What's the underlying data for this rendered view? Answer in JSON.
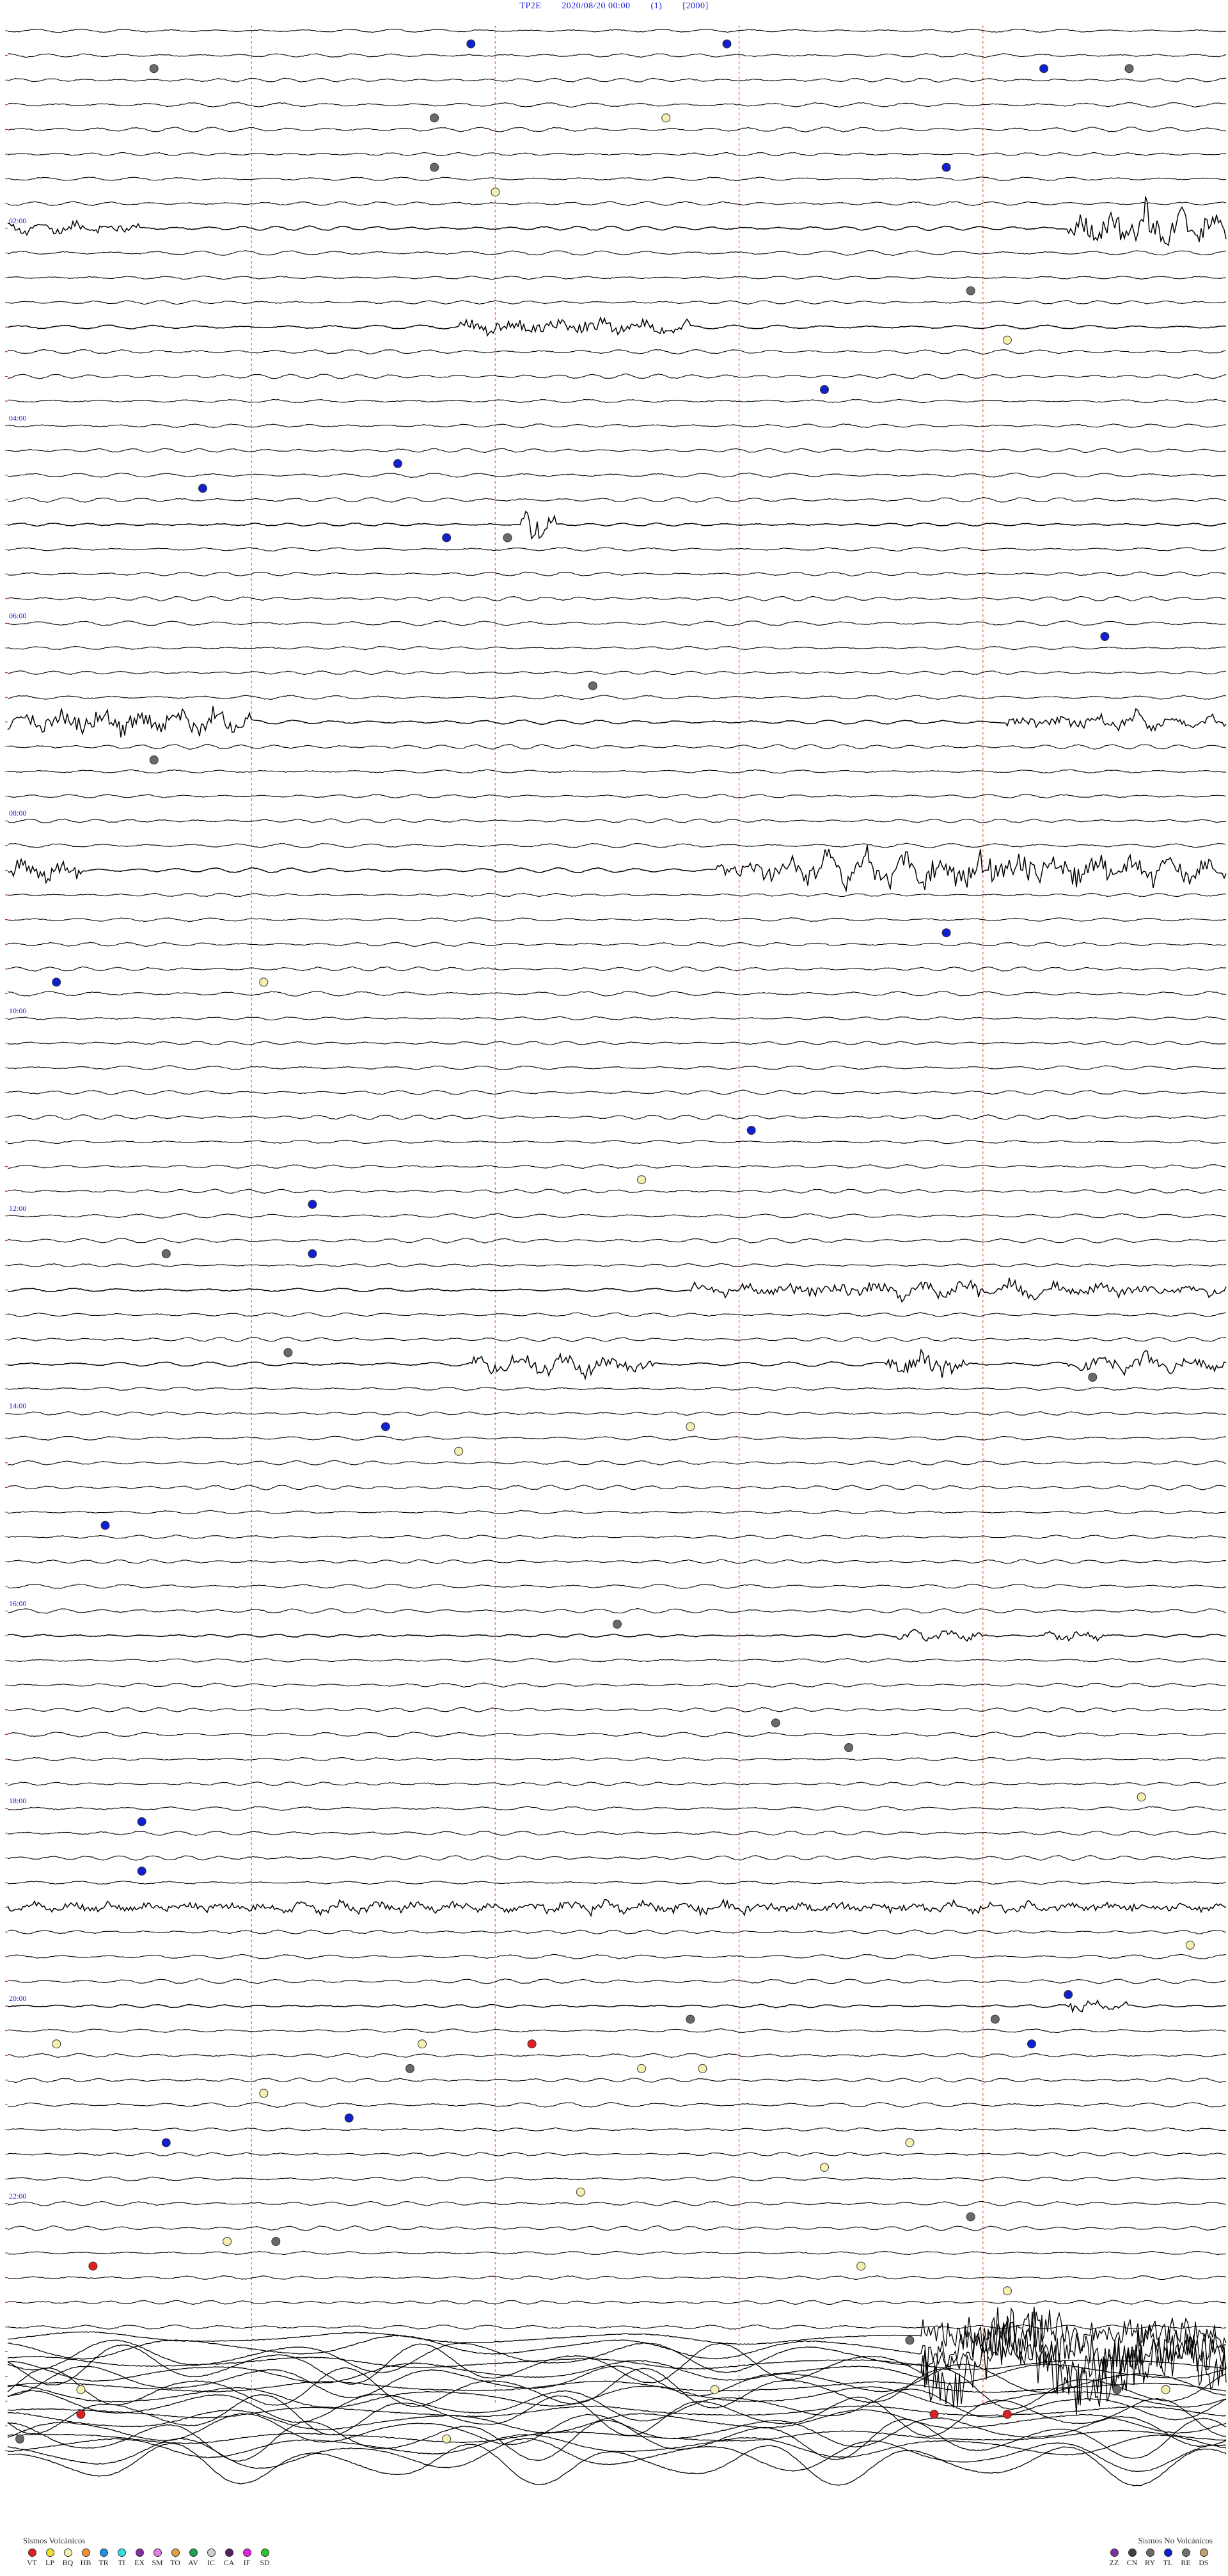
{
  "header": {
    "station": "TP2E",
    "datetime": "2020/08/20 00:00",
    "channel": "(1)",
    "scale": "[2000]"
  },
  "chart_data": {
    "type": "helicorder",
    "title": "TP2E   2020/08/20 00:00   (1)   [2000]",
    "lines_count": 96,
    "line_minutes": 15,
    "hour_labels": [
      {
        "line": 8,
        "text": "02:00"
      },
      {
        "line": 16,
        "text": "04:00"
      },
      {
        "line": 24,
        "text": "06:00"
      },
      {
        "line": 32,
        "text": "08:00"
      },
      {
        "line": 40,
        "text": "10:00"
      },
      {
        "line": 48,
        "text": "12:00"
      },
      {
        "line": 56,
        "text": "14:00"
      },
      {
        "line": 64,
        "text": "16:00"
      },
      {
        "line": 72,
        "text": "18:00"
      },
      {
        "line": 80,
        "text": "20:00"
      },
      {
        "line": 88,
        "text": "22:00"
      }
    ],
    "minute_markers": [
      3,
      6,
      9,
      12
    ],
    "bursts": [
      {
        "line": 8,
        "start": 0.87,
        "end": 1.0,
        "amp": 26,
        "dense": 2
      },
      {
        "line": 8,
        "start": 0.0,
        "end": 0.11,
        "amp": 5,
        "dense": 1
      },
      {
        "line": 12,
        "start": 0.37,
        "end": 0.56,
        "amp": 9,
        "dense": 1
      },
      {
        "line": 20,
        "start": 0.42,
        "end": 0.45,
        "amp": 24,
        "dense": 2
      },
      {
        "line": 28,
        "start": 0.0,
        "end": 0.2,
        "amp": 14,
        "dense": 2
      },
      {
        "line": 28,
        "start": 0.82,
        "end": 1.0,
        "amp": 7,
        "dense": 1
      },
      {
        "line": 34,
        "start": 0.0,
        "end": 0.06,
        "amp": 12,
        "dense": 1
      },
      {
        "line": 34,
        "start": 0.58,
        "end": 1.0,
        "amp": 18,
        "dense": 2
      },
      {
        "line": 51,
        "start": 0.56,
        "end": 1.0,
        "amp": 8,
        "dense": 1
      },
      {
        "line": 54,
        "start": 0.38,
        "end": 0.53,
        "amp": 12,
        "dense": 1
      },
      {
        "line": 54,
        "start": 0.72,
        "end": 0.79,
        "amp": 12,
        "dense": 1
      },
      {
        "line": 54,
        "start": 0.87,
        "end": 1.0,
        "amp": 8,
        "dense": 1
      },
      {
        "line": 65,
        "start": 0.73,
        "end": 0.8,
        "amp": 6,
        "dense": 1
      },
      {
        "line": 65,
        "start": 0.85,
        "end": 0.9,
        "amp": 6,
        "dense": 1
      },
      {
        "line": 76,
        "start": 0.0,
        "end": 1.0,
        "amp": 5,
        "dense": 1
      },
      {
        "line": 80,
        "start": 0.87,
        "end": 0.92,
        "amp": 7,
        "dense": 1
      },
      {
        "line": 94,
        "start": 0.75,
        "end": 1.0,
        "amp": 22,
        "dense": 2
      }
    ],
    "noisy_tail_from_line": 94,
    "event_markers": [
      {
        "line": 1,
        "pos": 0.59,
        "type": "TL"
      },
      {
        "line": 1,
        "pos": 0.38,
        "type": "TL"
      },
      {
        "line": 2,
        "pos": 0.85,
        "type": "TL"
      },
      {
        "line": 2,
        "pos": 0.12,
        "type": "RY"
      },
      {
        "line": 2,
        "pos": 0.92,
        "type": "RY"
      },
      {
        "line": 4,
        "pos": 0.35,
        "type": "RY"
      },
      {
        "line": 4,
        "pos": 0.54,
        "type": "BQ"
      },
      {
        "line": 6,
        "pos": 0.77,
        "type": "TL"
      },
      {
        "line": 6,
        "pos": 0.35,
        "type": "RY"
      },
      {
        "line": 7,
        "pos": 0.4,
        "type": "BQ"
      },
      {
        "line": 11,
        "pos": 0.79,
        "type": "RY"
      },
      {
        "line": 13,
        "pos": 0.82,
        "type": "BQ"
      },
      {
        "line": 15,
        "pos": 0.67,
        "type": "TL"
      },
      {
        "line": 18,
        "pos": 0.32,
        "type": "TL"
      },
      {
        "line": 19,
        "pos": 0.16,
        "type": "TL"
      },
      {
        "line": 21,
        "pos": 0.36,
        "type": "TL"
      },
      {
        "line": 21,
        "pos": 0.41,
        "type": "RY"
      },
      {
        "line": 25,
        "pos": 0.9,
        "type": "TL"
      },
      {
        "line": 27,
        "pos": 0.48,
        "type": "RY"
      },
      {
        "line": 30,
        "pos": 0.12,
        "type": "RY"
      },
      {
        "line": 37,
        "pos": 0.77,
        "type": "TL"
      },
      {
        "line": 39,
        "pos": 0.04,
        "type": "TL"
      },
      {
        "line": 39,
        "pos": 0.21,
        "type": "BQ"
      },
      {
        "line": 45,
        "pos": 0.61,
        "type": "TL"
      },
      {
        "line": 47,
        "pos": 0.52,
        "type": "BQ"
      },
      {
        "line": 48,
        "pos": 0.25,
        "type": "TL"
      },
      {
        "line": 50,
        "pos": 0.13,
        "type": "RY"
      },
      {
        "line": 50,
        "pos": 0.25,
        "type": "TL"
      },
      {
        "line": 54,
        "pos": 0.23,
        "type": "RY"
      },
      {
        "line": 55,
        "pos": 0.89,
        "type": "RY"
      },
      {
        "line": 57,
        "pos": 0.56,
        "type": "BQ"
      },
      {
        "line": 57,
        "pos": 0.31,
        "type": "TL"
      },
      {
        "line": 58,
        "pos": 0.37,
        "type": "BQ"
      },
      {
        "line": 61,
        "pos": 0.08,
        "type": "TL"
      },
      {
        "line": 65,
        "pos": 0.5,
        "type": "RY"
      },
      {
        "line": 69,
        "pos": 0.63,
        "type": "RY"
      },
      {
        "line": 70,
        "pos": 0.69,
        "type": "RY"
      },
      {
        "line": 72,
        "pos": 0.93,
        "type": "BQ"
      },
      {
        "line": 73,
        "pos": 0.11,
        "type": "TL"
      },
      {
        "line": 75,
        "pos": 0.11,
        "type": "TL"
      },
      {
        "line": 78,
        "pos": 0.97,
        "type": "BQ"
      },
      {
        "line": 80,
        "pos": 0.87,
        "type": "TL"
      },
      {
        "line": 81,
        "pos": 0.56,
        "type": "RY"
      },
      {
        "line": 81,
        "pos": 0.81,
        "type": "RY"
      },
      {
        "line": 82,
        "pos": 0.04,
        "type": "BQ"
      },
      {
        "line": 82,
        "pos": 0.84,
        "type": "TL"
      },
      {
        "line": 82,
        "pos": 0.43,
        "type": "VT"
      },
      {
        "line": 82,
        "pos": 0.34,
        "type": "BQ"
      },
      {
        "line": 83,
        "pos": 0.33,
        "type": "RY"
      },
      {
        "line": 83,
        "pos": 0.57,
        "type": "BQ"
      },
      {
        "line": 83,
        "pos": 0.52,
        "type": "BQ"
      },
      {
        "line": 84,
        "pos": 0.21,
        "type": "BQ"
      },
      {
        "line": 85,
        "pos": 0.28,
        "type": "TL"
      },
      {
        "line": 86,
        "pos": 0.13,
        "type": "TL"
      },
      {
        "line": 86,
        "pos": 0.74,
        "type": "BQ"
      },
      {
        "line": 87,
        "pos": 0.67,
        "type": "BQ"
      },
      {
        "line": 88,
        "pos": 0.47,
        "type": "BQ"
      },
      {
        "line": 89,
        "pos": 0.79,
        "type": "RY"
      },
      {
        "line": 90,
        "pos": 0.22,
        "type": "RY"
      },
      {
        "line": 90,
        "pos": 0.18,
        "type": "BQ"
      },
      {
        "line": 91,
        "pos": 0.07,
        "type": "VT"
      },
      {
        "line": 91,
        "pos": 0.7,
        "type": "BQ"
      },
      {
        "line": 92,
        "pos": 0.82,
        "type": "BQ"
      },
      {
        "line": 94,
        "pos": 0.74,
        "type": "RY"
      },
      {
        "line": 96,
        "pos": 0.06,
        "type": "BQ"
      },
      {
        "line": 96,
        "pos": 0.58,
        "type": "BQ"
      },
      {
        "line": 96,
        "pos": 0.95,
        "type": "BQ"
      },
      {
        "line": 96,
        "pos": 0.91,
        "type": "RY"
      },
      {
        "line": 97,
        "pos": 0.06,
        "type": "VT"
      },
      {
        "line": 97,
        "pos": 0.76,
        "type": "VT"
      },
      {
        "line": 97,
        "pos": 0.82,
        "type": "VT"
      },
      {
        "line": 98,
        "pos": 0.01,
        "type": "RY"
      },
      {
        "line": 98,
        "pos": 0.36,
        "type": "BQ"
      }
    ]
  },
  "legend_volcanic": {
    "title": "Sismos Volcánicos",
    "items": [
      {
        "label": "VT",
        "color": "#e02020"
      },
      {
        "label": "LP",
        "color": "#f0e030"
      },
      {
        "label": "BQ",
        "color": "#f5efb0"
      },
      {
        "label": "HB",
        "color": "#f09030"
      },
      {
        "label": "TR",
        "color": "#2090e0"
      },
      {
        "label": "TI",
        "color": "#30e0e0"
      },
      {
        "label": "EX",
        "color": "#8030a0"
      },
      {
        "label": "SM",
        "color": "#e080e0"
      },
      {
        "label": "TO",
        "color": "#e0a040"
      },
      {
        "label": "AV",
        "color": "#20a050"
      },
      {
        "label": "IC",
        "color": "#d0d0d0"
      },
      {
        "label": "CA",
        "color": "#502060"
      },
      {
        "label": "IF",
        "color": "#e020e0"
      },
      {
        "label": "SD",
        "color": "#30c030"
      }
    ]
  },
  "legend_nonvolcanic": {
    "title": "Sismos No Volcánicos",
    "items": [
      {
        "label": "ZZ",
        "color": "#8030a0"
      },
      {
        "label": "CN",
        "color": "#404040"
      },
      {
        "label": "RY",
        "color": "#6a6a6a"
      },
      {
        "label": "TL",
        "color": "#1020d0"
      },
      {
        "label": "RE",
        "color": "#707070"
      },
      {
        "label": "DS",
        "color": "#c0a070"
      }
    ]
  },
  "colors": {
    "trace": "#000000",
    "hour_label": "#1a1adc",
    "minute_marker": "#f08060",
    "left_tick": "#c00000"
  }
}
